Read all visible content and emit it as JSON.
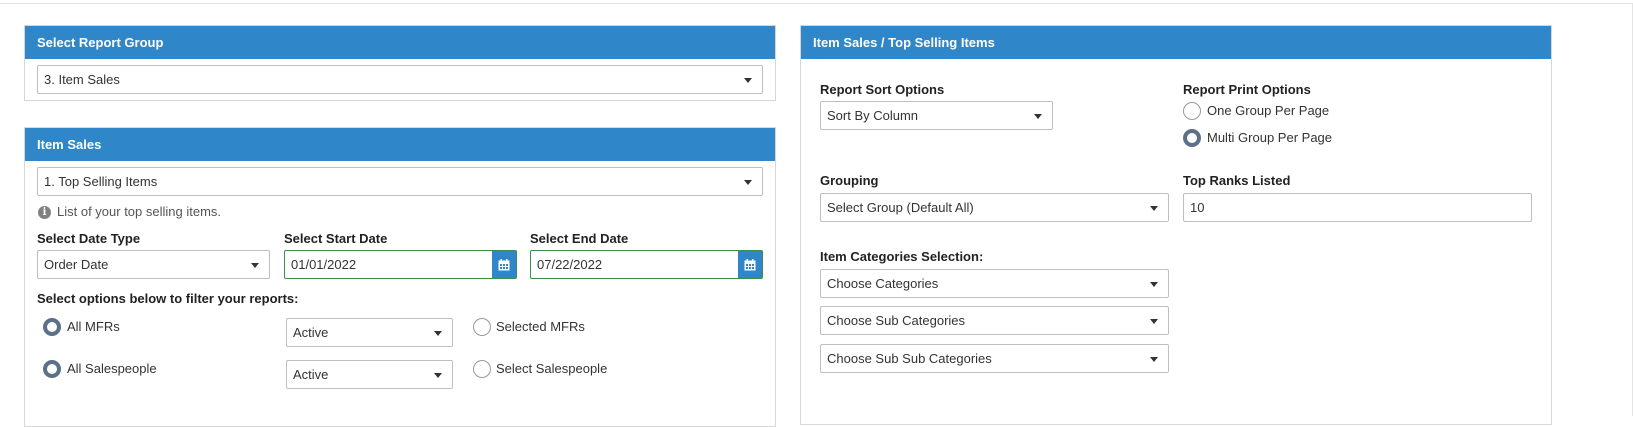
{
  "report_group_panel": {
    "title": "Select Report Group",
    "selected": "3. Item Sales"
  },
  "item_sales_panel": {
    "title": "Item Sales",
    "report_selected": "1. Top Selling Items",
    "info_text": "List of your top selling items.",
    "date_type_label": "Select Date Type",
    "date_type_value": "Order Date",
    "start_date_label": "Select Start Date",
    "start_date_value": "01/01/2022",
    "end_date_label": "Select End Date",
    "end_date_value": "07/22/2022",
    "filter_label": "Select options below to filter your reports:",
    "mfr": {
      "all_label": "All MFRs",
      "status": "Active",
      "selected_label": "Selected MFRs"
    },
    "salespeople": {
      "all_label": "All Salespeople",
      "status": "Active",
      "selected_label": "Select Salespeople"
    }
  },
  "top_selling_panel": {
    "title": "Item Sales / Top Selling Items",
    "sort_label": "Report Sort Options",
    "sort_value": "Sort By Column",
    "print_label": "Report Print Options",
    "print_options": [
      "One Group Per Page",
      "Multi Group Per Page"
    ],
    "print_selected_index": 1,
    "grouping_label": "Grouping",
    "grouping_value": "Select Group (Default All)",
    "top_ranks_label": "Top Ranks Listed",
    "top_ranks_value": "10",
    "categories_label": "Item Categories Selection:",
    "categories": [
      "Choose Categories",
      "Choose Sub Categories",
      "Choose Sub Sub Categories"
    ]
  },
  "colors": {
    "header_blue": "#2f86c8",
    "date_border_green": "#3c8d4a",
    "radio_checked": "#5c7088"
  },
  "icons": {
    "calendar": "calendar-icon",
    "info": "info-icon",
    "dropdown": "chevron-down-icon"
  }
}
